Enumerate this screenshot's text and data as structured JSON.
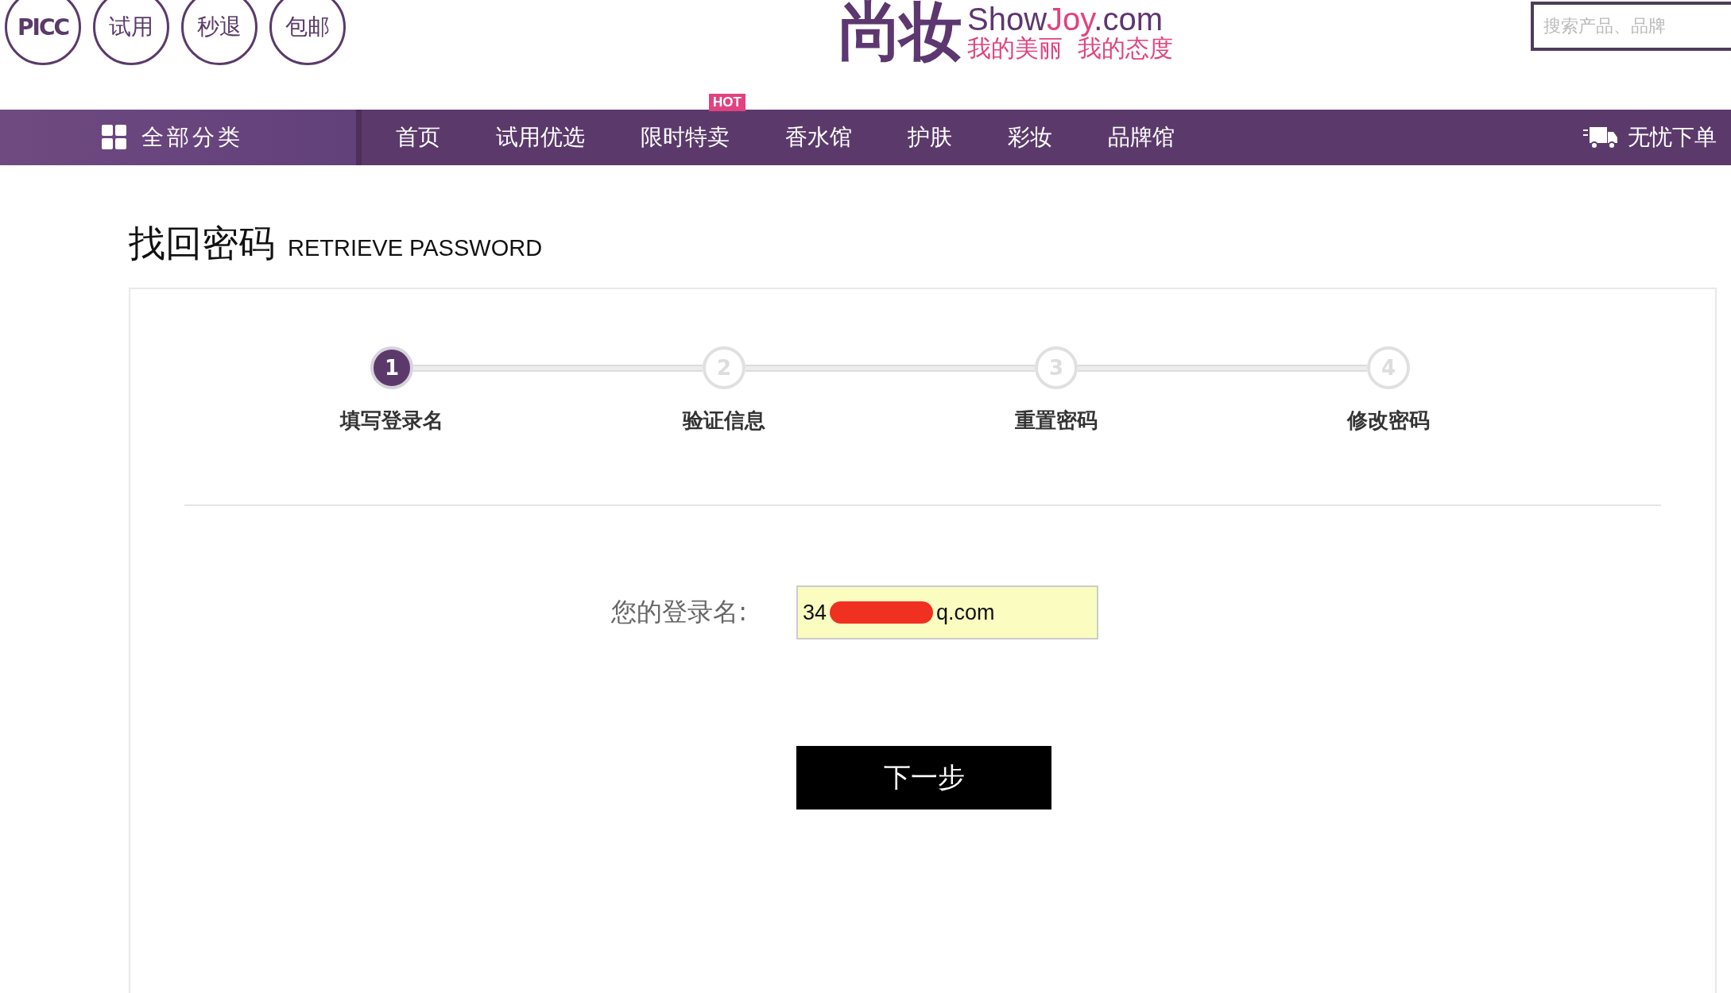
{
  "header": {
    "badges": [
      "PICC",
      "试用",
      "秒退",
      "包邮"
    ],
    "logo": {
      "mark": "尚妆",
      "site_part1": "Show",
      "site_part2": "Joy",
      "site_part3": ".com",
      "slogan": "我的美丽  我的态度"
    },
    "search": {
      "placeholder": "搜索产品、品牌"
    }
  },
  "nav": {
    "category": "全部分类",
    "items": [
      {
        "label": "首页"
      },
      {
        "label": "试用优选"
      },
      {
        "label": "限时特卖",
        "badge": "HOT"
      },
      {
        "label": "香水馆"
      },
      {
        "label": "护肤"
      },
      {
        "label": "彩妆"
      },
      {
        "label": "品牌馆"
      }
    ],
    "service": "无忧下单"
  },
  "page": {
    "title": "找回密码",
    "subtitle": "RETRIEVE PASSWORD"
  },
  "steps": [
    {
      "number": "1",
      "label": "填写登录名",
      "selected": true
    },
    {
      "number": "2",
      "label": "验证信息",
      "selected": false
    },
    {
      "number": "3",
      "label": "重置密码",
      "selected": false
    },
    {
      "number": "4",
      "label": "修改密码",
      "selected": false
    }
  ],
  "form": {
    "label": "您的登录名:",
    "value_start": "34",
    "value_end": "q.com",
    "redacted": true,
    "submit": "下一步"
  }
}
